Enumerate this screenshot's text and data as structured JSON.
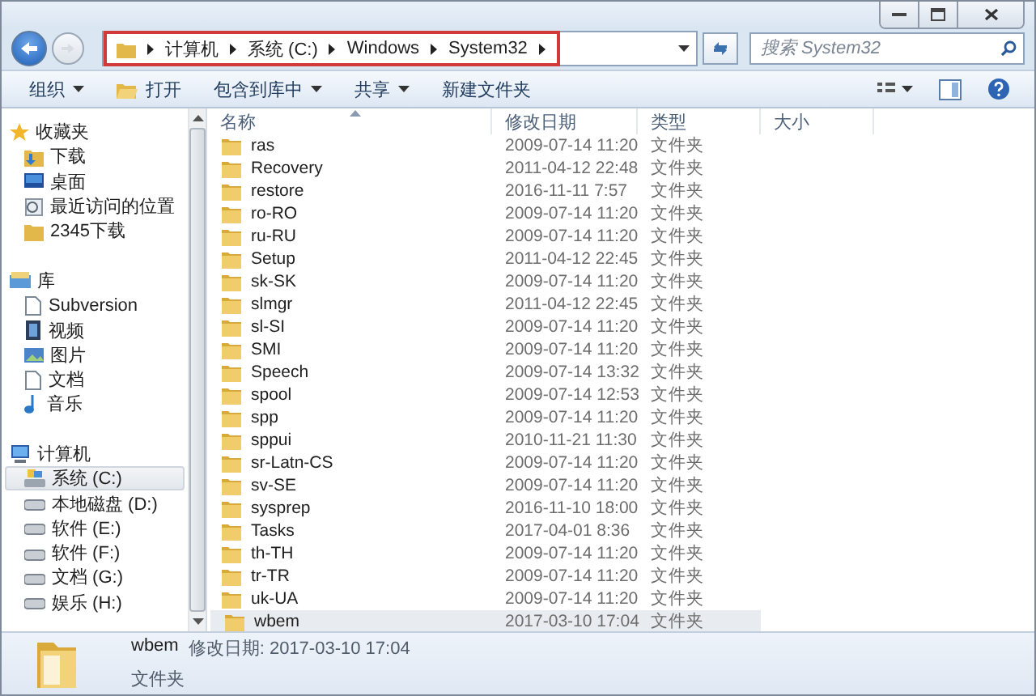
{
  "address": {
    "crumbs": [
      "计算机",
      "系统 (C:)",
      "Windows",
      "System32"
    ],
    "highlighted": true
  },
  "search": {
    "placeholder": "搜索 System32"
  },
  "toolbar": [
    {
      "label": "组织",
      "kind": "menu"
    },
    {
      "label": "打开",
      "kind": "open"
    },
    {
      "label": "包含到库中",
      "kind": "menu"
    },
    {
      "label": "共享",
      "kind": "menu"
    },
    {
      "label": "新建文件夹",
      "kind": "button"
    }
  ],
  "sidebar": [
    {
      "label": "收藏夹",
      "kind": "star",
      "selected": false,
      "children": [
        {
          "label": "下载",
          "kind": "download",
          "selected": false
        },
        {
          "label": "桌面",
          "kind": "desktop",
          "selected": false
        },
        {
          "label": "最近访问的位置",
          "kind": "recent",
          "selected": false
        },
        {
          "label": "2345下载",
          "kind": "folder",
          "selected": false
        }
      ]
    },
    {
      "label": "库",
      "kind": "library",
      "selected": false,
      "children": [
        {
          "label": "Subversion",
          "kind": "doc",
          "selected": false
        },
        {
          "label": "视频",
          "kind": "video",
          "selected": false
        },
        {
          "label": "图片",
          "kind": "picture",
          "selected": false
        },
        {
          "label": "文档",
          "kind": "doc",
          "selected": false
        },
        {
          "label": "音乐",
          "kind": "music",
          "selected": false
        }
      ]
    },
    {
      "label": "计算机",
      "kind": "computer",
      "selected": false,
      "children": [
        {
          "label": "系统 (C:)",
          "kind": "sysdrive",
          "selected": true
        },
        {
          "label": "本地磁盘 (D:)",
          "kind": "drive",
          "selected": false
        },
        {
          "label": "软件 (E:)",
          "kind": "drive",
          "selected": false
        },
        {
          "label": "软件 (F:)",
          "kind": "drive",
          "selected": false
        },
        {
          "label": "文档 (G:)",
          "kind": "drive",
          "selected": false
        },
        {
          "label": "娱乐 (H:)",
          "kind": "drive",
          "selected": false
        }
      ]
    }
  ],
  "table": {
    "columns": [
      {
        "label": "名称",
        "sorted": true
      },
      {
        "label": "修改日期",
        "sorted": false
      },
      {
        "label": "类型",
        "sorted": false
      },
      {
        "label": "大小",
        "sorted": false
      }
    ],
    "rows": [
      {
        "name": "ras",
        "date": "2009-07-14 11:20",
        "type": "文件夹",
        "selected": false
      },
      {
        "name": "Recovery",
        "date": "2011-04-12 22:48",
        "type": "文件夹",
        "selected": false
      },
      {
        "name": "restore",
        "date": "2016-11-11 7:57",
        "type": "文件夹",
        "selected": false
      },
      {
        "name": "ro-RO",
        "date": "2009-07-14 11:20",
        "type": "文件夹",
        "selected": false
      },
      {
        "name": "ru-RU",
        "date": "2009-07-14 11:20",
        "type": "文件夹",
        "selected": false
      },
      {
        "name": "Setup",
        "date": "2011-04-12 22:45",
        "type": "文件夹",
        "selected": false
      },
      {
        "name": "sk-SK",
        "date": "2009-07-14 11:20",
        "type": "文件夹",
        "selected": false
      },
      {
        "name": "slmgr",
        "date": "2011-04-12 22:45",
        "type": "文件夹",
        "selected": false
      },
      {
        "name": "sl-SI",
        "date": "2009-07-14 11:20",
        "type": "文件夹",
        "selected": false
      },
      {
        "name": "SMI",
        "date": "2009-07-14 11:20",
        "type": "文件夹",
        "selected": false
      },
      {
        "name": "Speech",
        "date": "2009-07-14 13:32",
        "type": "文件夹",
        "selected": false
      },
      {
        "name": "spool",
        "date": "2009-07-14 12:53",
        "type": "文件夹",
        "selected": false
      },
      {
        "name": "spp",
        "date": "2009-07-14 11:20",
        "type": "文件夹",
        "selected": false
      },
      {
        "name": "sppui",
        "date": "2010-11-21 11:30",
        "type": "文件夹",
        "selected": false
      },
      {
        "name": "sr-Latn-CS",
        "date": "2009-07-14 11:20",
        "type": "文件夹",
        "selected": false
      },
      {
        "name": "sv-SE",
        "date": "2009-07-14 11:20",
        "type": "文件夹",
        "selected": false
      },
      {
        "name": "sysprep",
        "date": "2016-11-10 18:00",
        "type": "文件夹",
        "selected": false
      },
      {
        "name": "Tasks",
        "date": "2017-04-01 8:36",
        "type": "文件夹",
        "selected": false
      },
      {
        "name": "th-TH",
        "date": "2009-07-14 11:20",
        "type": "文件夹",
        "selected": false
      },
      {
        "name": "tr-TR",
        "date": "2009-07-14 11:20",
        "type": "文件夹",
        "selected": false
      },
      {
        "name": "uk-UA",
        "date": "2009-07-14 11:20",
        "type": "文件夹",
        "selected": false
      },
      {
        "name": "wbem",
        "date": "2017-03-10 17:04",
        "type": "文件夹",
        "selected": true
      }
    ]
  },
  "details": {
    "name": "wbem",
    "modified": "修改日期: 2017-03-10 17:04",
    "type": "文件夹"
  }
}
